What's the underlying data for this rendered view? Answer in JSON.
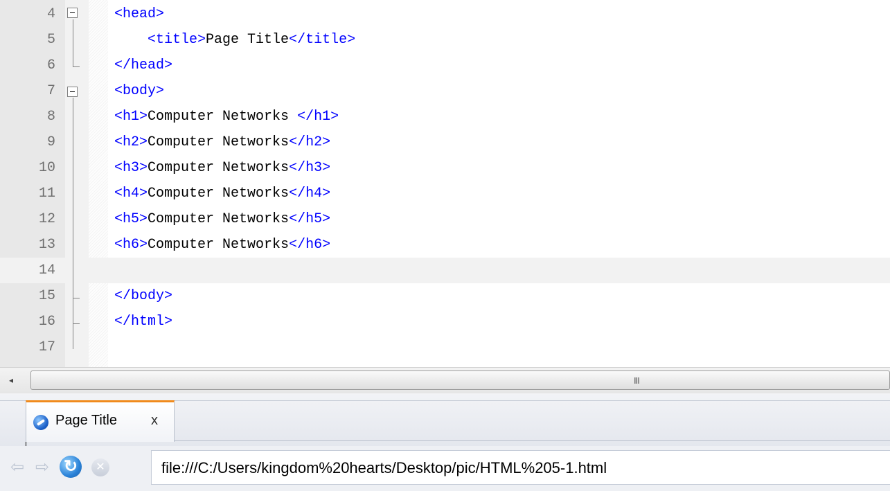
{
  "editor": {
    "lines": [
      {
        "num": "4",
        "tag1": "<head>",
        "text": "",
        "tag2": ""
      },
      {
        "num": "5",
        "tag1": "    <title>",
        "text": "Page Title",
        "tag2": "</title>"
      },
      {
        "num": "6",
        "tag1": "</head>",
        "text": "",
        "tag2": ""
      },
      {
        "num": "7",
        "tag1": "<body>",
        "text": "",
        "tag2": ""
      },
      {
        "num": "8",
        "tag1": "<h1>",
        "text": "Computer Networks ",
        "tag2": "</h1>"
      },
      {
        "num": "9",
        "tag1": "<h2>",
        "text": "Computer Networks",
        "tag2": "</h2>"
      },
      {
        "num": "10",
        "tag1": "<h3>",
        "text": "Computer Networks",
        "tag2": "</h3>"
      },
      {
        "num": "11",
        "tag1": "<h4>",
        "text": "Computer Networks",
        "tag2": "</h4>"
      },
      {
        "num": "12",
        "tag1": "<h5>",
        "text": "Computer Networks",
        "tag2": "</h5>"
      },
      {
        "num": "13",
        "tag1": "<h6>",
        "text": "Computer Networks",
        "tag2": "</h6>"
      },
      {
        "num": "14",
        "tag1": "",
        "text": "",
        "tag2": ""
      },
      {
        "num": "15",
        "tag1": "</body>",
        "text": "",
        "tag2": ""
      },
      {
        "num": "16",
        "tag1": "</html>",
        "text": "",
        "tag2": ""
      },
      {
        "num": "17",
        "tag1": "",
        "text": "",
        "tag2": ""
      }
    ],
    "tag_color": "#0000ff",
    "text_color": "#000000"
  },
  "scrollbar": {
    "left_arrow": "◂",
    "grip": "III"
  },
  "browser": {
    "tab": {
      "icon": "globe-icon",
      "title": "Page Title",
      "close": "x"
    },
    "nav": {
      "back_icon": "back-arrow-icon",
      "forward_icon": "forward-arrow-icon",
      "refresh_icon": "refresh-icon",
      "stop_icon": "stop-icon",
      "back_glyph": "⇦",
      "forward_glyph": "⇨",
      "refresh_glyph": "↻",
      "stop_glyph": "✕"
    },
    "url": "file:///C:/Users/kingdom%20hearts/Desktop/pic/HTML%205-1.html"
  }
}
